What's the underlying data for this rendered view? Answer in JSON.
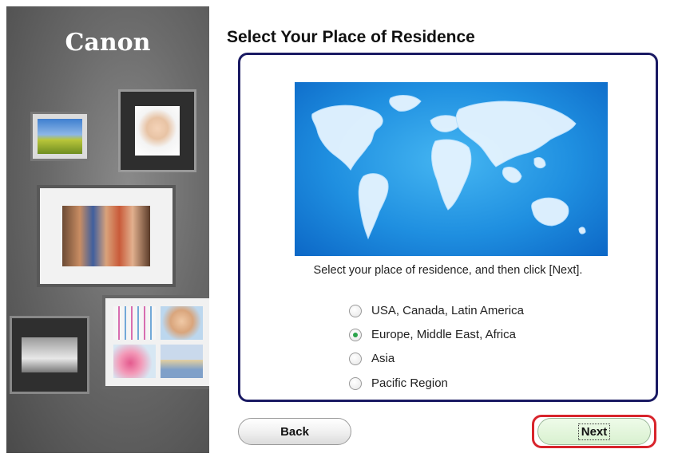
{
  "sidebar": {
    "brand": "Canon"
  },
  "page": {
    "title": "Select Your Place of Residence"
  },
  "dialog": {
    "instruction": "Select your place of residence, and then click [Next].",
    "options": [
      {
        "label": "USA, Canada, Latin America",
        "selected": false
      },
      {
        "label": "Europe, Middle East, Africa",
        "selected": true
      },
      {
        "label": "Asia",
        "selected": false
      },
      {
        "label": "Pacific Region",
        "selected": false
      }
    ]
  },
  "buttons": {
    "back": "Back",
    "next": "Next"
  },
  "colors": {
    "accent_border": "#1a1a63",
    "next_highlight": "#d8242c",
    "selected_dot": "#2aa34a"
  }
}
